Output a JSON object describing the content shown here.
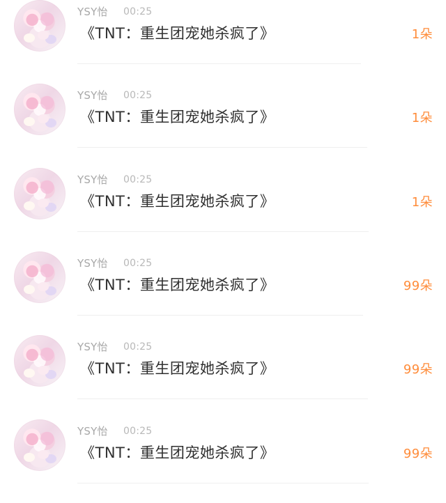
{
  "messages": [
    {
      "username": "YSY怡",
      "time": "00:25",
      "content": "《TNT：重生团宠她杀疯了》",
      "count": "1朵"
    },
    {
      "username": "YSY怡",
      "time": "00:25",
      "content": "《TNT：重生团宠她杀疯了》",
      "count": "1朵"
    },
    {
      "username": "YSY怡",
      "time": "00:25",
      "content": "《TNT：重生团宠她杀疯了》",
      "count": "1朵"
    },
    {
      "username": "YSY怡",
      "time": "00:25",
      "content": "《TNT：重生团宠她杀疯了》",
      "count": "99朵"
    },
    {
      "username": "YSY怡",
      "time": "00:25",
      "content": "《TNT：重生团宠她杀疯了》",
      "count": "99朵"
    },
    {
      "username": "YSY怡",
      "time": "00:25",
      "content": "《TNT：重生团宠她杀疯了》",
      "count": "99朵"
    }
  ]
}
